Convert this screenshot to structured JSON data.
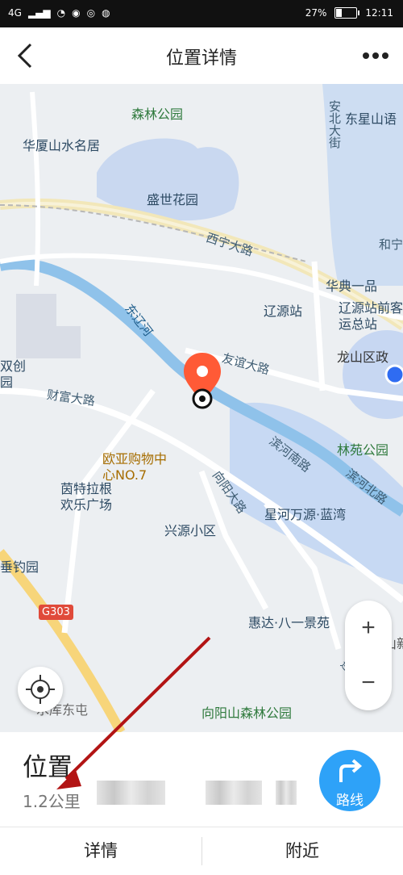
{
  "status": {
    "signal": "4G",
    "battery": "27%",
    "time": "12:11"
  },
  "nav": {
    "title": "位置详情"
  },
  "map": {
    "pois": [
      {
        "label": "森林公园"
      },
      {
        "label": "华厦山水名居"
      },
      {
        "label": "盛世花园"
      },
      {
        "label": "东星山语"
      },
      {
        "label": "安北大街"
      },
      {
        "label": "西宁大路"
      },
      {
        "label": "和宁"
      },
      {
        "label": "华典一品"
      },
      {
        "label": "辽源站"
      },
      {
        "label": "辽源站前客运总站"
      },
      {
        "label": "龙山区政"
      },
      {
        "label": "友谊大路"
      },
      {
        "label": "东辽河"
      },
      {
        "label": "双创园"
      },
      {
        "label": "财富大路"
      },
      {
        "label": "欧亚购物中心NO.7"
      },
      {
        "label": "茵特拉根欢乐广场"
      },
      {
        "label": "兴源小区"
      },
      {
        "label": "向阳大路"
      },
      {
        "label": "滨河南路"
      },
      {
        "label": "滨河北路"
      },
      {
        "label": "星河万源·蓝湾"
      },
      {
        "label": "林苑公园"
      },
      {
        "label": "垂钓园"
      },
      {
        "label": "G303"
      },
      {
        "label": "惠达·八一景苑"
      },
      {
        "label": "龙山新城"
      },
      {
        "label": "向阳山森林公园"
      },
      {
        "label": "水库东屯"
      },
      {
        "label": "连阳路"
      }
    ]
  },
  "info": {
    "place_title": "位置",
    "distance": "1.2公里",
    "route_label": "路线"
  },
  "tabs": {
    "details": "详情",
    "nearby": "附近"
  }
}
